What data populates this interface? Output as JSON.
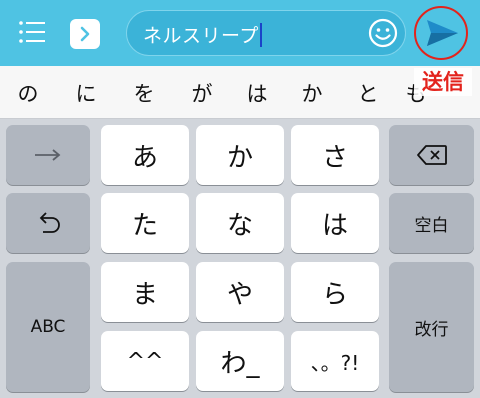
{
  "compose": {
    "text": "ネルスリープ",
    "send_annotation": "送信"
  },
  "icons": {
    "menu": "menu-icon",
    "more": "chevron-right-icon",
    "emoji": "smile-icon",
    "send": "paper-plane-icon",
    "next": "arrow-right-icon",
    "backspace": "backspace-icon",
    "undo": "undo-icon"
  },
  "suggestions": [
    "の",
    "に",
    "を",
    "が",
    "は",
    "か",
    "と",
    "も"
  ],
  "keyboard": {
    "row1": [
      "あ",
      "か",
      "さ"
    ],
    "row2": [
      "た",
      "な",
      "は"
    ],
    "row3": [
      "ま",
      "や",
      "ら"
    ],
    "row4": [
      "^^",
      "わ_",
      "、。?!"
    ],
    "space_label": "空白",
    "abc_label": "ABC",
    "enter_label": "改行"
  },
  "colors": {
    "header": "#4fc3e3",
    "annotation": "#e3231c",
    "keyboard_bg": "#d1d5db",
    "function_key": "#b0b6bf"
  }
}
